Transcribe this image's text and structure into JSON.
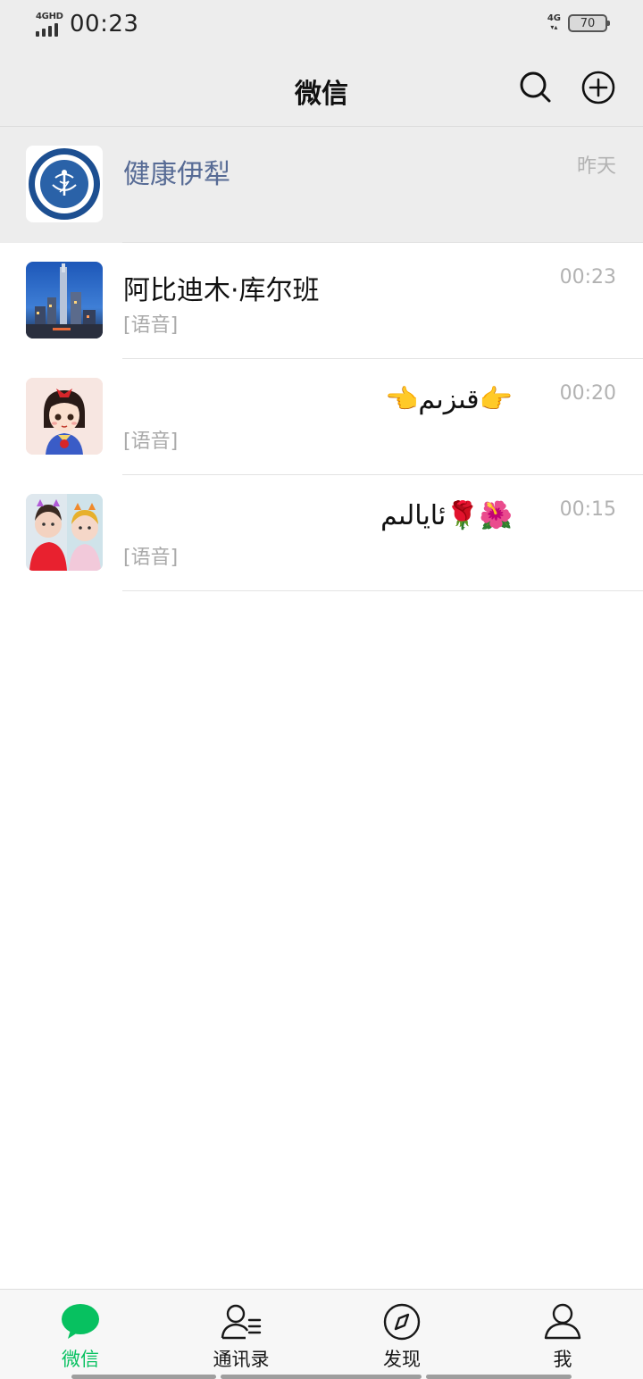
{
  "status_bar": {
    "network_label": "4GHD",
    "time": "00:23",
    "secondary_network": "4G",
    "battery": "70"
  },
  "nav": {
    "title": "微信",
    "icons": [
      "search-icon",
      "add-circle-icon"
    ]
  },
  "chats": [
    {
      "name": "健康伊犁",
      "time": "昨天",
      "preview": "",
      "pinned": true,
      "name_is_link": true,
      "avatar": "health-organization-seal"
    },
    {
      "name": "阿比迪木·库尔班",
      "time": "00:23",
      "preview": "[语音]",
      "avatar": "city-skyline-photo"
    },
    {
      "name": "👉قىزىم👈",
      "time": "00:20",
      "preview": "[语音]",
      "avatar": "cartoon-princess"
    },
    {
      "name": "🌺🌹ئايالىم",
      "time": "00:15",
      "preview": "[语音]",
      "avatar": "selfie-photo"
    }
  ],
  "tabs": [
    {
      "label": "微信",
      "icon": "chat-bubble-icon",
      "active": true
    },
    {
      "label": "通讯录",
      "icon": "contacts-icon",
      "active": false
    },
    {
      "label": "发现",
      "icon": "compass-icon",
      "active": false
    },
    {
      "label": "我",
      "icon": "person-icon",
      "active": false
    }
  ],
  "colors": {
    "accent": "#07c160",
    "link": "#576b95",
    "header_bg": "#ededed",
    "time_gray": "#b2b2b2"
  }
}
